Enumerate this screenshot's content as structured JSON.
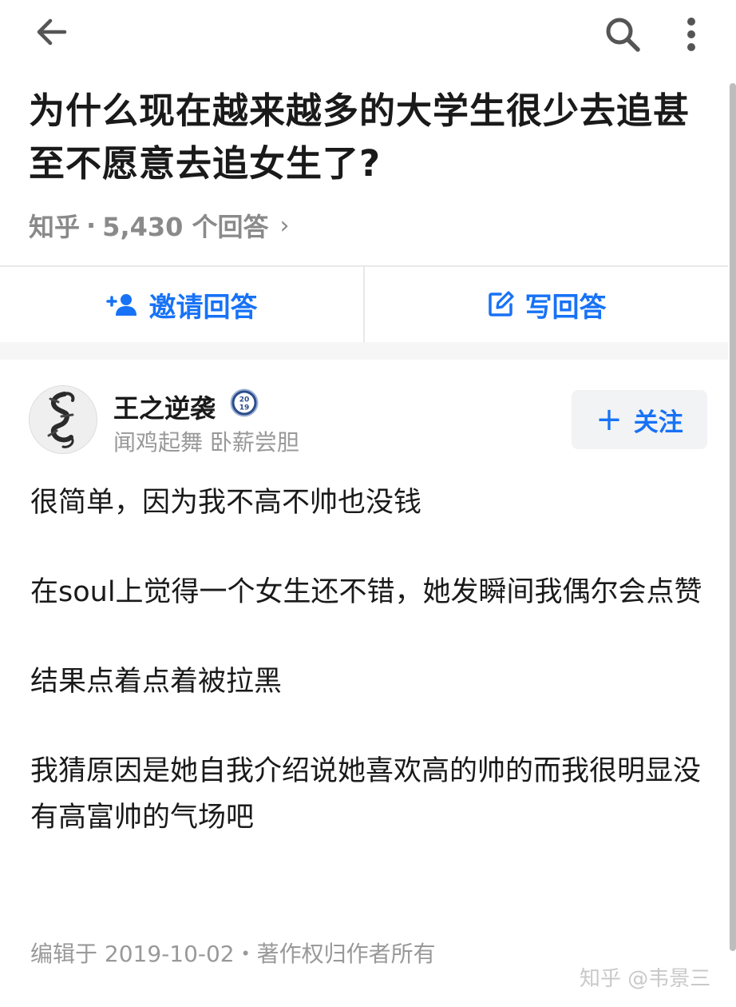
{
  "topbar": {
    "back_icon": "arrow-left-icon",
    "search_icon": "search-icon",
    "more_icon": "more-vertical-icon"
  },
  "question": {
    "title": "为什么现在越来越多的大学生很少去追甚至不愿意去追女生了?",
    "source": "知乎",
    "separator": "·",
    "answer_count": "5,430 个回答",
    "chevron": "›"
  },
  "actions": {
    "invite_label": "邀请回答",
    "invite_icon": "add-person-icon",
    "write_label": "写回答",
    "write_icon": "edit-icon"
  },
  "author": {
    "name": "王之逆袭",
    "badge_text_top": "20",
    "badge_text_bottom": "19",
    "bio": "闻鸡起舞 卧薪尝胆",
    "follow_label": "关注",
    "follow_icon": "plus-icon"
  },
  "answer": {
    "paragraphs": [
      "很简单，因为我不高不帅也没钱",
      "在soul上觉得一个女生还不错，她发瞬间我偶尔会点赞",
      "结果点着点着被拉黑",
      "我猜原因是她自我介绍说她喜欢高的帅的而我很明显没有高富帅的气场吧"
    ],
    "footer": "编辑于 2019-10-02・著作权归作者所有"
  },
  "watermark": "知乎 @韦景三",
  "colors": {
    "accent": "#1772f6",
    "text": "#1a1a1a",
    "muted": "#999999",
    "band": "#f6f6f6"
  }
}
